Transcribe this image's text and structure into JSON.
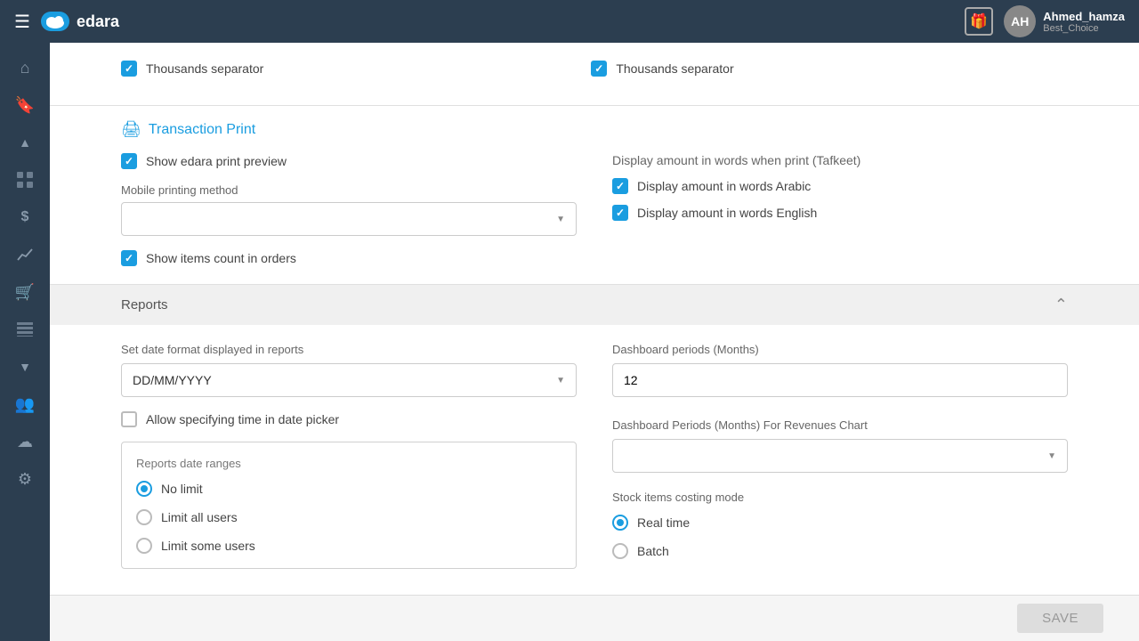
{
  "topbar": {
    "menu_icon": "☰",
    "logo_text": "edara",
    "username": "Ahmed_hamza",
    "company": "Best_Choice"
  },
  "sidebar_nav": {
    "items": [
      {
        "icon": "⌂",
        "name": "home-icon"
      },
      {
        "icon": "🔖",
        "name": "bookmark-icon"
      },
      {
        "icon": "▲",
        "name": "collapse-up-icon"
      },
      {
        "icon": "⊞",
        "name": "grid-icon"
      },
      {
        "icon": "$",
        "name": "dollar-icon"
      },
      {
        "icon": "📈",
        "name": "chart-icon"
      },
      {
        "icon": "🛒",
        "name": "cart-icon"
      },
      {
        "icon": "▦",
        "name": "table-icon"
      },
      {
        "icon": "▼",
        "name": "expand-icon"
      },
      {
        "icon": "👥",
        "name": "users-icon"
      },
      {
        "icon": "☁",
        "name": "cloud-icon"
      },
      {
        "icon": "⚙",
        "name": "settings-icon"
      }
    ]
  },
  "top_section": {
    "thousands_separator_left": {
      "label": "Thousands separator",
      "checked": true
    },
    "thousands_separator_right": {
      "label": "Thousands separator",
      "checked": true
    }
  },
  "transaction_print": {
    "section_title": "Transaction Print",
    "show_edara_preview": {
      "label": "Show edara print preview",
      "checked": true
    },
    "mobile_printing_method": {
      "label": "Mobile printing method",
      "value": ""
    },
    "show_items_count": {
      "label": "Show items count in orders",
      "checked": true
    },
    "display_amount_title": "Display amount in words when print (Tafkeet)",
    "display_arabic": {
      "label": "Display amount in words Arabic",
      "checked": true
    },
    "display_english": {
      "label": "Display amount in words English",
      "checked": true
    }
  },
  "reports": {
    "section_title": "Reports",
    "date_format_label": "Set date format displayed in reports",
    "date_format_value": "DD/MM/YYYY",
    "allow_time_label": "Allow specifying time in date picker",
    "allow_time_checked": false,
    "date_ranges_title": "Reports date ranges",
    "date_ranges": [
      {
        "label": "No limit",
        "checked": true
      },
      {
        "label": "Limit all users",
        "checked": false
      },
      {
        "label": "Limit some users",
        "checked": false
      }
    ],
    "dashboard_periods_label": "Dashboard periods (Months)",
    "dashboard_periods_value": "12",
    "dashboard_revenues_label": "Dashboard Periods (Months) For Revenues Chart",
    "dashboard_revenues_value": "",
    "stock_costing_label": "Stock items costing mode",
    "stock_costing_options": [
      {
        "label": "Real time",
        "checked": true
      },
      {
        "label": "Batch",
        "checked": false
      }
    ]
  },
  "footer": {
    "save_label": "SAVE"
  }
}
